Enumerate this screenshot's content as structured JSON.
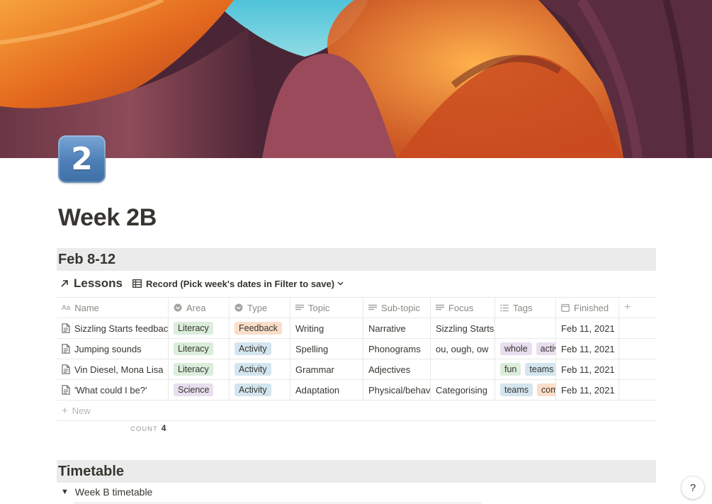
{
  "page": {
    "icon": "2",
    "icon_name": "keycap-digit-two-icon",
    "title": "Week 2B"
  },
  "sections": {
    "week_heading": "Feb 8-12",
    "timetable_heading": "Timetable"
  },
  "database": {
    "title": "Lessons",
    "view_label": "Record (Pick week's dates in Filter to save)",
    "columns": [
      "Name",
      "Area",
      "Type",
      "Topic",
      "Sub-topic",
      "Focus",
      "Tags",
      "Finished"
    ],
    "rows": [
      {
        "name": "Sizzling Starts feedbac",
        "area": "Literacy",
        "type": "Feedback",
        "topic": "Writing",
        "subtopic": "Narrative",
        "focus": "Sizzling Starts",
        "tags": [],
        "finished": "Feb 11, 2021"
      },
      {
        "name": "Jumping sounds",
        "area": "Literacy",
        "type": "Activity",
        "topic": "Spelling",
        "subtopic": "Phonograms",
        "focus": "ou, ough, ow",
        "tags": [
          "whole",
          "activ"
        ],
        "finished": "Feb 11, 2021"
      },
      {
        "name": "Vin Diesel, Mona Lisa",
        "area": "Literacy",
        "type": "Activity",
        "topic": "Grammar",
        "subtopic": "Adjectives",
        "focus": "",
        "tags": [
          "fun",
          "teams"
        ],
        "finished": "Feb 11, 2021"
      },
      {
        "name": "'What could I be?'",
        "area": "Science",
        "type": "Activity",
        "topic": "Adaptation",
        "subtopic": "Physical/behavi",
        "focus": "Categorising",
        "tags": [
          "teams",
          "com"
        ],
        "finished": "Feb 11, 2021"
      }
    ],
    "new_label": "New",
    "count_label": "COUNT",
    "count_value": "4"
  },
  "timetable": {
    "toggle_label": "Week B timetable"
  },
  "help_label": "?",
  "colors": {
    "text": "#37352f",
    "section_bg": "#ebebeb",
    "literacy_bg": "#dbeddb",
    "science_bg": "#e8deee",
    "feedback_bg": "#fadec9",
    "activity_bg": "#d3e5ef",
    "tag_whole_bg": "#e8deee",
    "tag_activ_bg": "#e8deee",
    "tag_fun_bg": "#dbeddb",
    "tag_teams_bg": "#d3e5ef",
    "tag_com_bg": "#fadec9"
  }
}
